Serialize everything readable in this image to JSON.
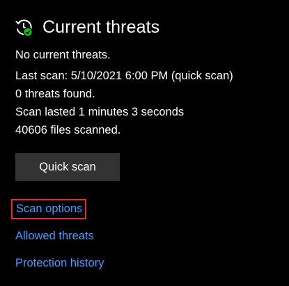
{
  "header": {
    "icon": "history-check-icon",
    "title": "Current threats",
    "icon_badge_color": "#16c60c"
  },
  "status": {
    "summary": "No current threats.",
    "last_scan": "Last scan: 5/10/2021 6:00 PM (quick scan)",
    "threats_found": "0 threats found.",
    "duration": "Scan lasted 1 minutes 3 seconds",
    "files_scanned": "40606 files scanned."
  },
  "actions": {
    "quick_scan_label": "Quick scan"
  },
  "links": {
    "scan_options": "Scan options",
    "allowed_threats": "Allowed threats",
    "protection_history": "Protection history"
  },
  "colors": {
    "background": "#000000",
    "text": "#ffffff",
    "link": "#4c9bf5",
    "button_bg": "#333333",
    "highlight_border": "#e03034"
  }
}
